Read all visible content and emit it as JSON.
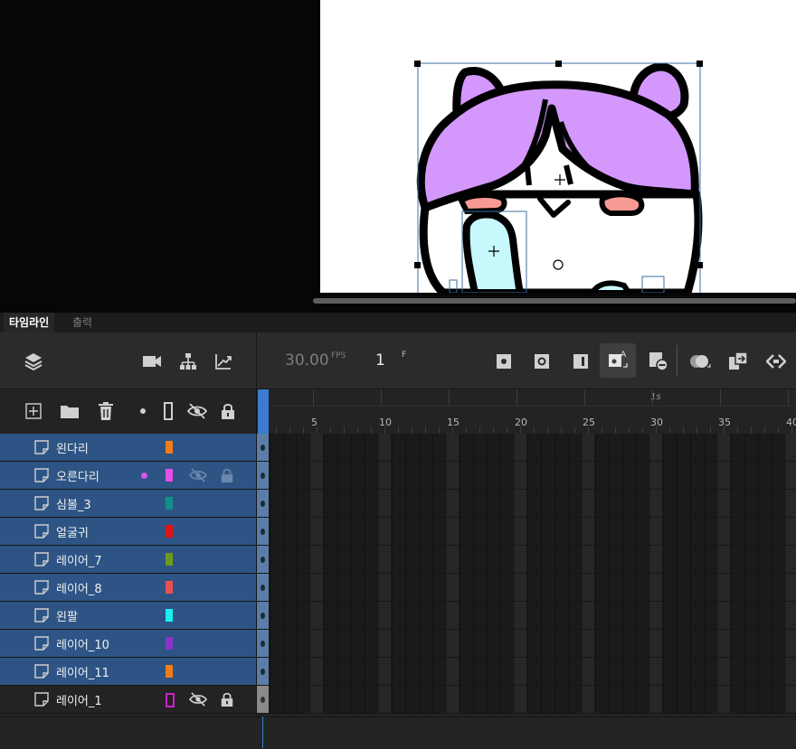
{
  "panel_tabs": {
    "timeline": "타임라인",
    "output": "출력"
  },
  "toolbar": {
    "fps_value": "30.00",
    "fps_unit": "FPS",
    "frame_value": "1",
    "frame_unit": "F"
  },
  "ruler": {
    "second_marker": "1s",
    "labels": [
      "5",
      "10",
      "15",
      "20",
      "25",
      "30",
      "35",
      "40"
    ]
  },
  "layers": [
    {
      "name": "왼다리",
      "color": "#f07d1a",
      "selected": true
    },
    {
      "name": "오른다리",
      "color": "#e44fe6",
      "selected": true,
      "hidden": true,
      "locked": true,
      "active": true
    },
    {
      "name": "심볼_3",
      "color": "#138f8a",
      "selected": true
    },
    {
      "name": "얼굴귀",
      "color": "#e01414",
      "selected": true
    },
    {
      "name": "레이어_7",
      "color": "#6d9a1e",
      "selected": true
    },
    {
      "name": "레이어_8",
      "color": "#ee5050",
      "selected": true
    },
    {
      "name": "왼팔",
      "color": "#19f0f0",
      "selected": true
    },
    {
      "name": "레이어_10",
      "color": "#8a35c9",
      "selected": true
    },
    {
      "name": "레이어_11",
      "color": "#f07d1a",
      "selected": true
    },
    {
      "name": "레이어_1",
      "color": "#d020d0",
      "selected": false,
      "hidden": true,
      "locked": true,
      "outline": true
    }
  ],
  "icons": {
    "layers": "layers-icon",
    "camera": "camera-icon",
    "parenting": "hierarchy-icon",
    "graph": "graph-icon",
    "add_layer": "add-layer-icon",
    "folder": "folder-icon",
    "delete": "trash-icon",
    "eye": "eye-hidden-icon",
    "lock": "lock-icon"
  }
}
